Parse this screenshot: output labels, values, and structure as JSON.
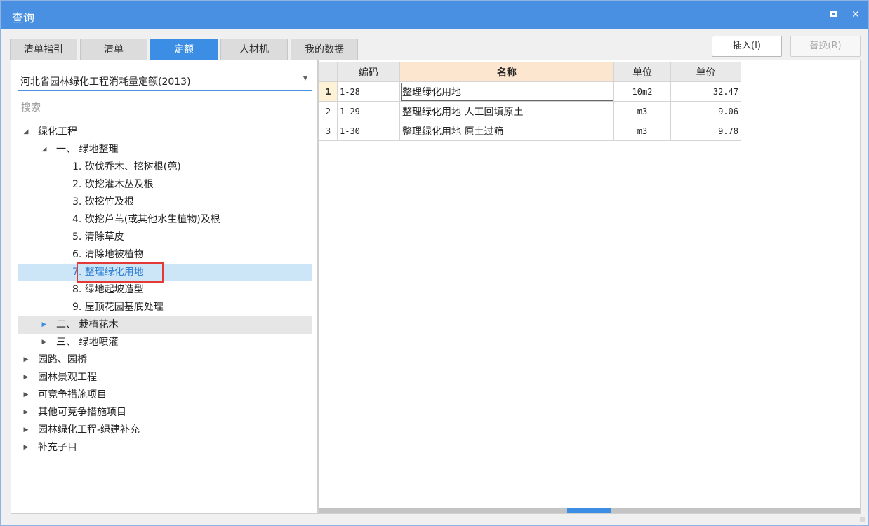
{
  "window": {
    "title": "查询",
    "maximize_label": "",
    "close_label": "✕"
  },
  "tabs": [
    {
      "label": "清单指引",
      "active": false
    },
    {
      "label": "清单",
      "active": false
    },
    {
      "label": "定额",
      "active": true
    },
    {
      "label": "人材机",
      "active": false
    },
    {
      "label": "我的数据",
      "active": false
    }
  ],
  "toolbar": {
    "insert_label": "插入(I)",
    "replace_label": "替换(R)"
  },
  "left": {
    "selected_quota": "河北省园林绿化工程消耗量定额(2013)",
    "search_placeholder": "搜索",
    "tree": [
      {
        "label": "绿化工程",
        "expanded": true
      },
      {
        "label": "一、 绿地整理",
        "expanded": true
      },
      {
        "label": "1. 砍伐乔木、挖树根(蔸)"
      },
      {
        "label": "2. 砍挖灌木丛及根"
      },
      {
        "label": "3. 砍挖竹及根"
      },
      {
        "label": "4. 砍挖芦苇(或其他水生植物)及根"
      },
      {
        "label": "5. 清除草皮"
      },
      {
        "label": "6. 清除地被植物"
      },
      {
        "label": "7. 整理绿化用地",
        "selected": true
      },
      {
        "label": "8. 绿地起坡造型"
      },
      {
        "label": "9. 屋顶花园基底处理"
      },
      {
        "label": "二、 栽植花木",
        "expanded": false
      },
      {
        "label": "三、 绿地喷灌",
        "expanded": false
      },
      {
        "label": "园路、园桥",
        "expanded": false
      },
      {
        "label": "园林景观工程",
        "expanded": false
      },
      {
        "label": "可竞争措施项目",
        "expanded": false
      },
      {
        "label": "其他可竞争措施项目",
        "expanded": false
      },
      {
        "label": "园林绿化工程-绿建补充",
        "expanded": false
      },
      {
        "label": "补充子目",
        "expanded": false
      }
    ]
  },
  "grid": {
    "headers": {
      "code": "编码",
      "name": "名称",
      "unit": "单位",
      "price": "单价"
    },
    "rows": [
      {
        "num": "1",
        "code": "1-28",
        "name": "整理绿化用地",
        "unit": "10m2",
        "price": "32.47"
      },
      {
        "num": "2",
        "code": "1-29",
        "name": "整理绿化用地 人工回填原土",
        "unit": "m3",
        "price": "9.06"
      },
      {
        "num": "3",
        "code": "1-30",
        "name": "整理绿化用地 原土过筛",
        "unit": "m3",
        "price": "9.78"
      }
    ]
  },
  "colors": {
    "title_bar": "#4a90e2",
    "active_tab": "#3c8ee5",
    "selection": "#cde6f7",
    "highlight_box": "#e53935",
    "name_header": "#fce6cf"
  }
}
